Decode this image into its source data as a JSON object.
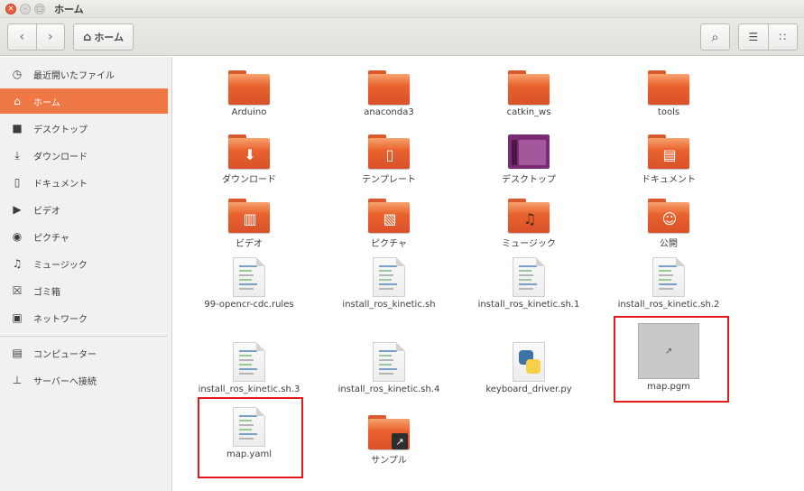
{
  "window": {
    "title": "ホーム"
  },
  "toolbar": {
    "path_label": "ホーム"
  },
  "sidebar": {
    "items": [
      {
        "label": "最近開いたファイル",
        "icon": "clock-icon"
      },
      {
        "label": "ホーム",
        "icon": "home-icon"
      },
      {
        "label": "デスクトップ",
        "icon": "desktop-icon"
      },
      {
        "label": "ダウンロード",
        "icon": "download-icon"
      },
      {
        "label": "ドキュメント",
        "icon": "document-icon"
      },
      {
        "label": "ビデオ",
        "icon": "video-icon"
      },
      {
        "label": "ピクチャ",
        "icon": "camera-icon"
      },
      {
        "label": "ミュージック",
        "icon": "music-icon"
      },
      {
        "label": "ゴミ箱",
        "icon": "trash-icon"
      },
      {
        "label": "ネットワーク",
        "icon": "network-icon"
      },
      {
        "label": "コンピューター",
        "icon": "computer-icon"
      },
      {
        "label": "サーバーへ接続",
        "icon": "server-icon"
      }
    ]
  },
  "files": [
    {
      "name": "Arduino",
      "kind": "folder"
    },
    {
      "name": "anaconda3",
      "kind": "folder"
    },
    {
      "name": "catkin_ws",
      "kind": "folder"
    },
    {
      "name": "tools",
      "kind": "folder"
    },
    {
      "name": "ダウンロード",
      "kind": "folder-download"
    },
    {
      "name": "テンプレート",
      "kind": "folder-templates"
    },
    {
      "name": "デスクトップ",
      "kind": "folder-desktop"
    },
    {
      "name": "ドキュメント",
      "kind": "folder-documents"
    },
    {
      "name": "ビデオ",
      "kind": "folder-video"
    },
    {
      "name": "ピクチャ",
      "kind": "folder-pictures"
    },
    {
      "name": "ミュージック",
      "kind": "folder-music"
    },
    {
      "name": "公開",
      "kind": "folder-public"
    },
    {
      "name": "99-opencr-cdc.rules",
      "kind": "text"
    },
    {
      "name": "install_ros_kinetic.sh",
      "kind": "text"
    },
    {
      "name": "install_ros_kinetic.sh.1",
      "kind": "text"
    },
    {
      "name": "install_ros_kinetic.sh.2",
      "kind": "text"
    },
    {
      "name": "install_ros_kinetic.sh.3",
      "kind": "text"
    },
    {
      "name": "install_ros_kinetic.sh.4",
      "kind": "text"
    },
    {
      "name": "keyboard_driver.py",
      "kind": "python"
    },
    {
      "name": "map.pgm",
      "kind": "image"
    },
    {
      "name": "map.yaml",
      "kind": "text"
    },
    {
      "name": "サンプル",
      "kind": "folder-link"
    }
  ],
  "highlight_color": "#e21a1a",
  "accent_color": "#f07746"
}
